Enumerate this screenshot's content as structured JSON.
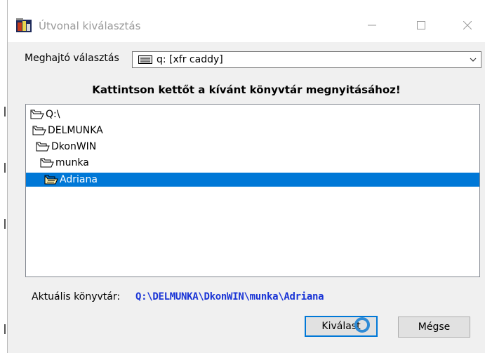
{
  "window": {
    "title": "Útvonal kiválasztás",
    "minimize_glyph": "—",
    "maximize_glyph": "☐",
    "close_glyph": "✕"
  },
  "drive": {
    "label": "Meghajtó választás",
    "selected": "q: [xfr caddy]",
    "icon": "drive-icon"
  },
  "instruction": "Kattintson kettőt a kívánt könyvtár megnyitásához!",
  "tree": {
    "items": [
      {
        "label": "Q:\\",
        "level": 0,
        "selected": false,
        "icon": "folder-open-icon"
      },
      {
        "label": "DELMUNKA",
        "level": 1,
        "selected": false,
        "icon": "folder-open-icon"
      },
      {
        "label": "DkonWIN",
        "level": 2,
        "selected": false,
        "icon": "folder-open-icon"
      },
      {
        "label": "munka",
        "level": 3,
        "selected": false,
        "icon": "folder-open-icon"
      },
      {
        "label": "Adriana",
        "level": 4,
        "selected": true,
        "icon": "folder-open-icon"
      }
    ]
  },
  "current_dir": {
    "label": "Aktuális könyvtár:",
    "path": "Q:\\DELMUNKA\\DkonWIN\\munka\\Adriana"
  },
  "buttons": {
    "ok_label": "Kiválast",
    "cancel_label": "Mégse"
  },
  "colors": {
    "selection": "#0078d7",
    "path_text": "#1a35d6"
  }
}
